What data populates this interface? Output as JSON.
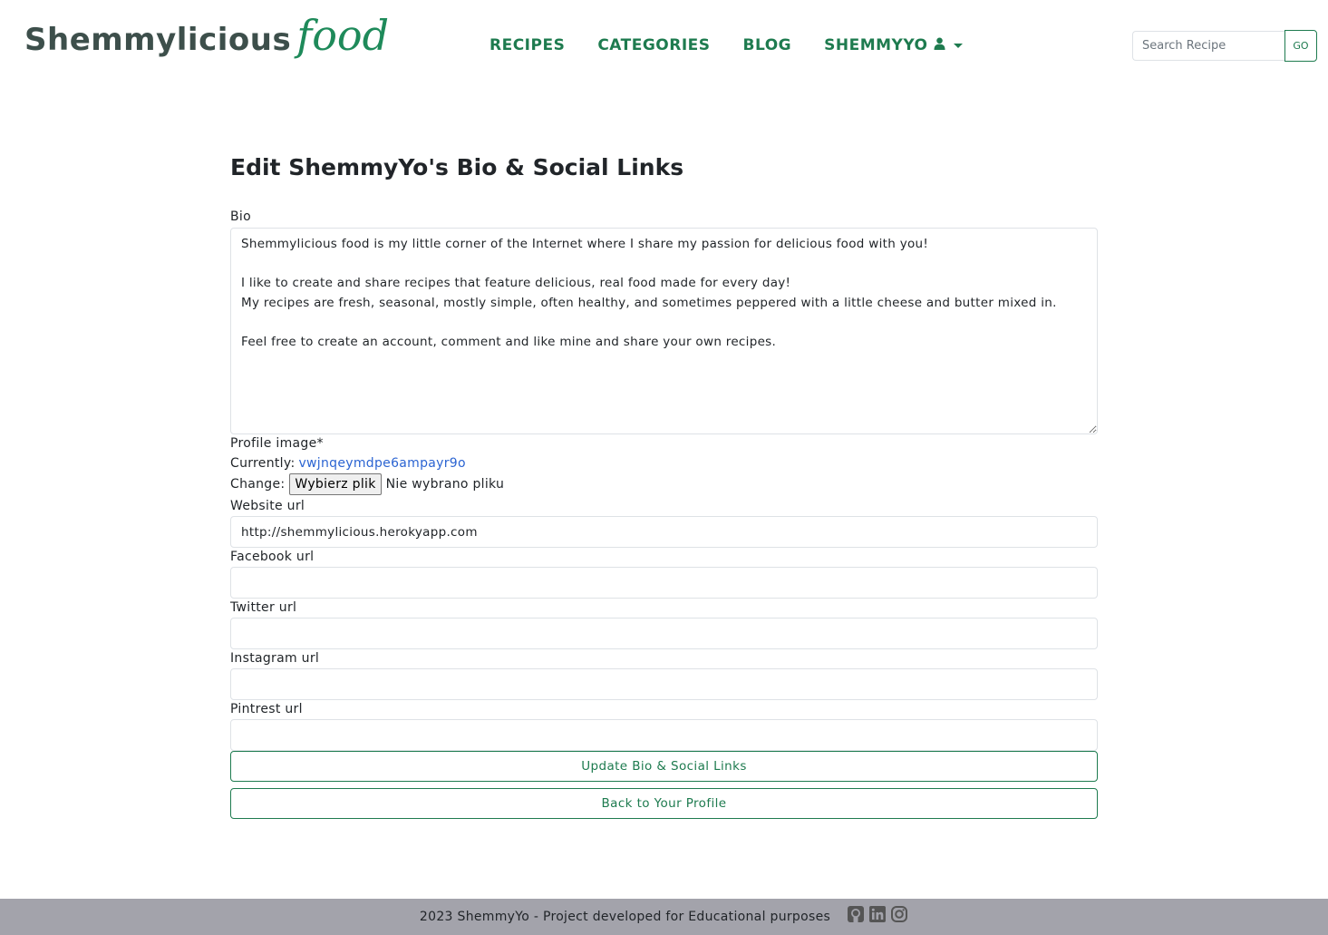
{
  "brand": {
    "main": "Shemmylicious",
    "script": "food"
  },
  "nav": {
    "items": [
      {
        "label": "RECIPES"
      },
      {
        "label": "CATEGORIES"
      },
      {
        "label": "BLOG"
      },
      {
        "label": "SHEMMYYO",
        "icon": "person-icon",
        "dropdown": true
      }
    ]
  },
  "search": {
    "placeholder": "Search Recipe",
    "button_label": "GO"
  },
  "page": {
    "title": "Edit ShemmyYo's Bio & Social Links"
  },
  "form": {
    "bio_label": "Bio",
    "bio_value": "Shemmylicious food is my little corner of the Internet where I share my passion for delicious food with you!\n\nI like to create and share recipes that feature delicious, real food made for every day!\nMy recipes are fresh, seasonal, mostly simple, often healthy, and sometimes peppered with a little cheese and butter mixed in.\n\nFeel free to create an account, comment and like mine and share your own recipes.",
    "profile_image_label": "Profile image*",
    "currently_label": "Currently:",
    "currently_link": "vwjnqeymdpe6ampayr9o",
    "change_label": "Change:",
    "file_button": "Wybierz plik",
    "file_status": "Nie wybrano pliku",
    "website_label": "Website url",
    "website_value": "http://shemmylicious.herokyapp.com",
    "facebook_label": "Facebook url",
    "facebook_value": "",
    "twitter_label": "Twitter url",
    "twitter_value": "",
    "instagram_label": "Instagram url",
    "instagram_value": "",
    "pintrest_label": "Pintrest url",
    "pintrest_value": "",
    "submit_label": "Update Bio & Social Links",
    "back_label": "Back to Your Profile"
  },
  "footer": {
    "text": "2023 ShemmyYo - Project developed for Educational purposes",
    "icons": [
      "github-icon",
      "linkedin-icon",
      "instagram-icon"
    ]
  },
  "colors": {
    "accent": "#1e7b4f",
    "link": "#2b64d2",
    "footer_bg": "#a3a3ab",
    "brand_text": "#3d4f4b"
  }
}
